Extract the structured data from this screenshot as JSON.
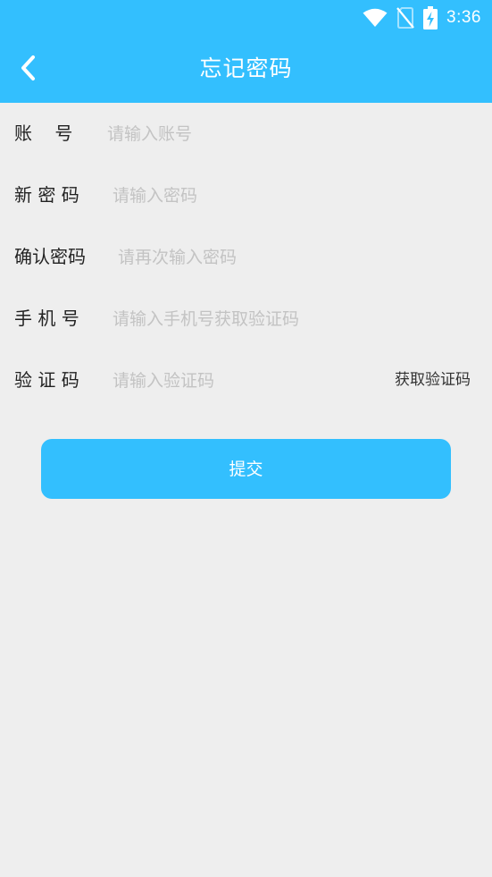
{
  "status_bar": {
    "time": "3:36",
    "icons": [
      "wifi-icon",
      "no-sim-icon",
      "battery-charging-icon"
    ]
  },
  "header": {
    "title": "忘记密码",
    "back_icon": "chevron-left-icon",
    "background": "#33bffe"
  },
  "form": {
    "account": {
      "label": "账    号",
      "placeholder": "请输入账号",
      "value": ""
    },
    "new_password": {
      "label": "新 密 码",
      "placeholder": "请输入密码",
      "value": ""
    },
    "confirm_password": {
      "label": "确认密码",
      "placeholder": "请再次输入密码",
      "value": ""
    },
    "phone": {
      "label": "手 机 号",
      "placeholder": "请输入手机号获取验证码",
      "value": ""
    },
    "verify_code": {
      "label": "验 证 码",
      "placeholder": "请输入验证码",
      "value": "",
      "get_code_label": "获取验证码"
    }
  },
  "submit": {
    "label": "提交"
  },
  "colors": {
    "accent": "#33bffe",
    "background": "#eeeeee",
    "placeholder": "#c3c3c3"
  }
}
